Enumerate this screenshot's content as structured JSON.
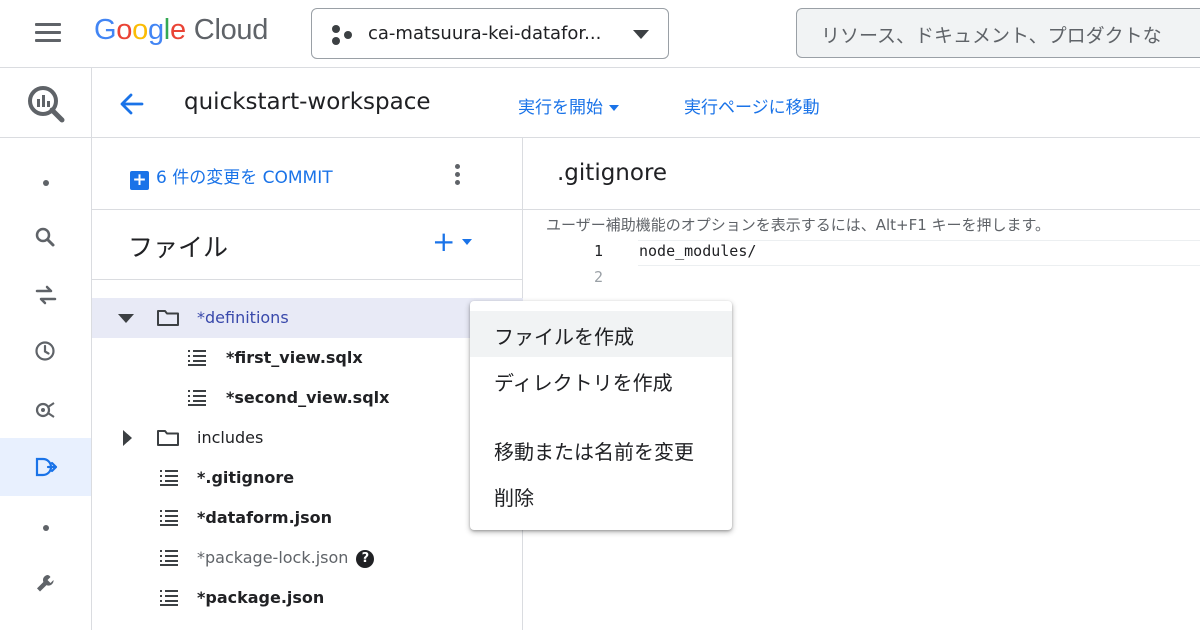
{
  "topbar": {
    "logo_letters": [
      {
        "ch": "G",
        "color": "#4285F4"
      },
      {
        "ch": "o",
        "color": "#EA4335"
      },
      {
        "ch": "o",
        "color": "#FBBC05"
      },
      {
        "ch": "g",
        "color": "#4285F4"
      },
      {
        "ch": "l",
        "color": "#34A853"
      },
      {
        "ch": "e",
        "color": "#EA4335"
      }
    ],
    "logo_suffix": "Cloud",
    "project_name": "ca-matsuura-kei-datafor...",
    "search_placeholder": "リソース、ドキュメント、プロダクトな"
  },
  "workspace": {
    "title": "quickstart-workspace",
    "run_label": "実行を開始",
    "goto_label": "実行ページに移動"
  },
  "files": {
    "commit_label": "6 件の変更を COMMIT",
    "header_label": "ファイル",
    "add_label": "+",
    "tree": [
      {
        "name": "*definitions",
        "kind": "folder",
        "expanded": true
      },
      {
        "name": "*first_view.sqlx",
        "kind": "file"
      },
      {
        "name": "*second_view.sqlx",
        "kind": "file"
      },
      {
        "name": "includes",
        "kind": "folder",
        "expanded": false
      },
      {
        "name": "*.gitignore",
        "kind": "file"
      },
      {
        "name": "*dataform.json",
        "kind": "file"
      },
      {
        "name": "*package-lock.json",
        "kind": "file"
      },
      {
        "name": "*package.json",
        "kind": "file"
      }
    ],
    "help_glyph": "?"
  },
  "editor": {
    "filename": ".gitignore",
    "a11y_hint": "ユーザー補助機能のオプションを表示するには、Alt+F1 キーを押します。",
    "line_numbers": [
      "1",
      "2"
    ],
    "code_line_1": "node_modules/"
  },
  "context_menu": {
    "items": [
      "ファイルを作成",
      "ディレクトリを作成",
      "移動または名前を変更",
      "削除"
    ]
  },
  "colors": {
    "accent": "#1a73e8",
    "selected_row": "#e8eaf6",
    "active_rail": "#e8f0fe"
  }
}
